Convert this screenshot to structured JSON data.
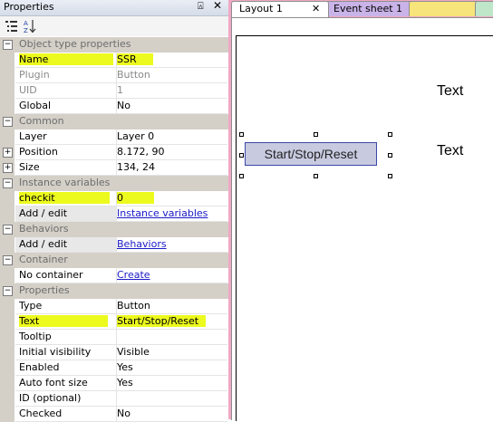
{
  "panel": {
    "title": "Properties",
    "pin_glyph": "⍓",
    "close_glyph": "✕"
  },
  "toolbar": {
    "sort_categories_icon": "categorized-icon",
    "sort_az_icon": "sort-az-icon",
    "sort_az_text": "A↓Z"
  },
  "properties": {
    "object_type": {
      "label": "Object type properties",
      "name_label": "Name",
      "name_value": "SSR",
      "plugin_label": "Plugin",
      "plugin_value": "Button",
      "uid_label": "UID",
      "uid_value": "1",
      "global_label": "Global",
      "global_value": "No"
    },
    "common": {
      "label": "Common",
      "layer_label": "Layer",
      "layer_value": "Layer 0",
      "position_label": "Position",
      "position_value": "8.172, 90",
      "size_label": "Size",
      "size_value": "134, 24"
    },
    "instance_vars": {
      "label": "Instance variables",
      "var_name": "checkit",
      "var_value": "0",
      "add_label": "Add / edit",
      "add_link": "Instance variables"
    },
    "behaviors": {
      "label": "Behaviors",
      "add_label": "Add / edit",
      "add_link": "Behaviors"
    },
    "container": {
      "label": "Container",
      "no_container_label": "No container",
      "create_link": "Create"
    },
    "props": {
      "label": "Properties",
      "type_label": "Type",
      "type_value": "Button",
      "text_label": "Text",
      "text_value": "Start/Stop/Reset",
      "tooltip_label": "Tooltip",
      "tooltip_value": "",
      "visibility_label": "Initial visibility",
      "visibility_value": "Visible",
      "enabled_label": "Enabled",
      "enabled_value": "Yes",
      "autofont_label": "Auto font size",
      "autofont_value": "Yes",
      "id_label": "ID (optional)",
      "id_value": "",
      "checked_label": "Checked",
      "checked_value": "No"
    },
    "collapse_glyph": "−",
    "expand_glyph": "+"
  },
  "tabs": {
    "layout": "Layout 1",
    "layout_close": "✕",
    "event_sheet": "Event sheet 1"
  },
  "canvas": {
    "button_text": "Start/Stop/Reset",
    "text1": "Text",
    "text2": "Text"
  },
  "colors": {
    "highlight": "#ecfa1e",
    "layout_tab_bg": "#f0a9c4",
    "event_tab_bg": "#c9b3e8"
  }
}
